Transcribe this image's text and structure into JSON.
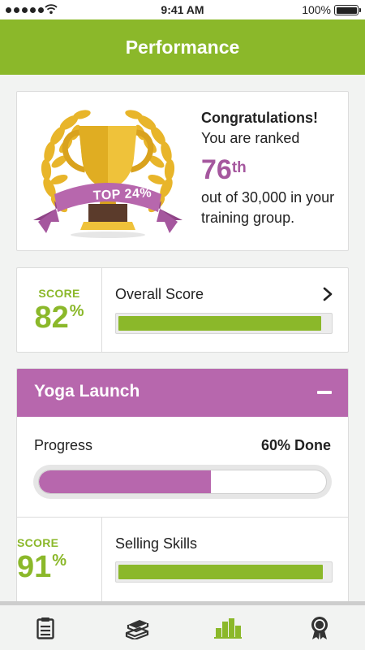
{
  "status_bar": {
    "time": "9:41 AM",
    "battery": "100%"
  },
  "header": {
    "title": "Performance"
  },
  "ranking": {
    "badge": "TOP 24%",
    "congrats": "Congratulations!",
    "ranked_text": "You are ranked",
    "rank": "76",
    "rank_suffix": "th",
    "group_text": "out of 30,000 in your training group."
  },
  "overall": {
    "score_label": "SCORE",
    "score": "82",
    "score_unit": "%",
    "title": "Overall Score",
    "progress": 0.96
  },
  "course": {
    "title": "Yoga Launch",
    "progress_label": "Progress",
    "progress_text": "60% Done",
    "progress": 0.6,
    "skill": {
      "score_label": "SCORE",
      "score": "91",
      "score_unit": "%",
      "title": "Selling Skills",
      "progress": 0.97
    }
  },
  "tabs": [
    {
      "icon": "clipboard-icon"
    },
    {
      "icon": "books-icon"
    },
    {
      "icon": "bar-chart-icon",
      "active": true
    },
    {
      "icon": "award-ribbon-icon"
    }
  ],
  "colors": {
    "brand_green": "#8bb82a",
    "accent_purple": "#b767ad",
    "rank_purple": "#a5579e",
    "trophy_gold": "#e8b52a"
  }
}
